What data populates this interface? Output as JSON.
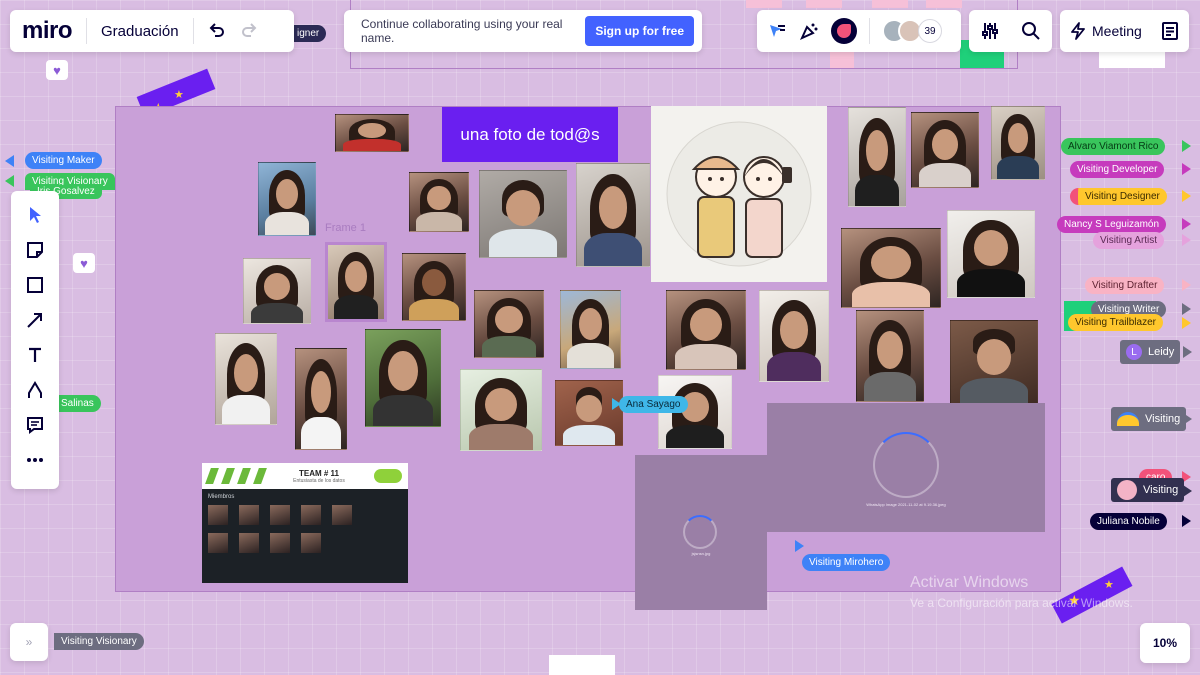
{
  "app": {
    "logo": "miro",
    "board_title": "Graduación"
  },
  "banner": {
    "text": "Continue collaborating using your real name.",
    "signup_label": "Sign up for free"
  },
  "header_right": {
    "collaborator_count": "39",
    "meeting_label": "Meeting"
  },
  "frame": {
    "title": "una foto de tod@s",
    "frame_label": "Frame 1",
    "team_card": {
      "title": "TEAM # 11",
      "subtitle": "Entusiasta de los datos",
      "members_label": "Miembros"
    },
    "loading_caption_large": "WhatsApp Image 2021-11-02 at 9.19.36.jpeg",
    "loading_caption_small": "jsjsnsn.jpg"
  },
  "cursors_left": [
    {
      "label": "Visiting Maker",
      "color": "#3e82f7"
    },
    {
      "label": "Visiting Visionary",
      "color": "#39c55c"
    },
    {
      "label": "Iris Gosalvez",
      "color": "#39c55c"
    },
    {
      "label": "Salinas",
      "color": "#39c55c"
    },
    {
      "label": "Visiting Visionary",
      "color": "#6d6d80"
    }
  ],
  "cursors_right": [
    {
      "label": "Alvaro Viamont Rico",
      "color": "#39c55c"
    },
    {
      "label": "Visiting Developer",
      "color": "#c63bbd"
    },
    {
      "label": "Visiting Designer",
      "color": "#ffc72d",
      "text_color": "#3a2b00"
    },
    {
      "label": "Nancy S Leguizamón",
      "color": "#c63bbd"
    },
    {
      "label": "Visiting Artist",
      "color": "#e5a2dd",
      "text_color": "#5b2a55"
    },
    {
      "label": "Visiting Drafter",
      "color": "#f9b3c4",
      "text_color": "#5e2332"
    },
    {
      "label": "Visiting Writer",
      "color": "#6d6d80"
    },
    {
      "label": "Visiting Trailblazer",
      "color": "#ffc72d",
      "text_color": "#3a2b00"
    }
  ],
  "user_chips": [
    {
      "label": "Leidy",
      "avatar_letter": "L",
      "color": "#6d6d80"
    },
    {
      "label": "Visiting",
      "color": "#6d6d80"
    },
    {
      "label": "caro",
      "color": "#f2527a"
    },
    {
      "label": "Visiting",
      "color": "#323050"
    },
    {
      "label": "Juliana Nobile",
      "color": "#050038"
    }
  ],
  "canvas_cursors": [
    {
      "label": "Ana Sayago",
      "color": "#3fb7e8"
    },
    {
      "label": "Visiting Mirohero",
      "color": "#3e82f7"
    }
  ],
  "partial_tag": "igner",
  "watermark": {
    "line1": "Activar Windows",
    "line2": "Ve a Configuración para activar Windows."
  },
  "zoom": "10%",
  "icons": {
    "undo": "undo-icon",
    "redo": "redo-icon",
    "reactions": "reactions-icon",
    "settings": "sliders-icon",
    "search": "search-icon",
    "meeting": "lightning-icon",
    "notes": "notes-icon"
  },
  "colors": {
    "brand": "#4262ff",
    "frame_fill": "#c9a0d8",
    "title_card": "#6a1ff0"
  }
}
